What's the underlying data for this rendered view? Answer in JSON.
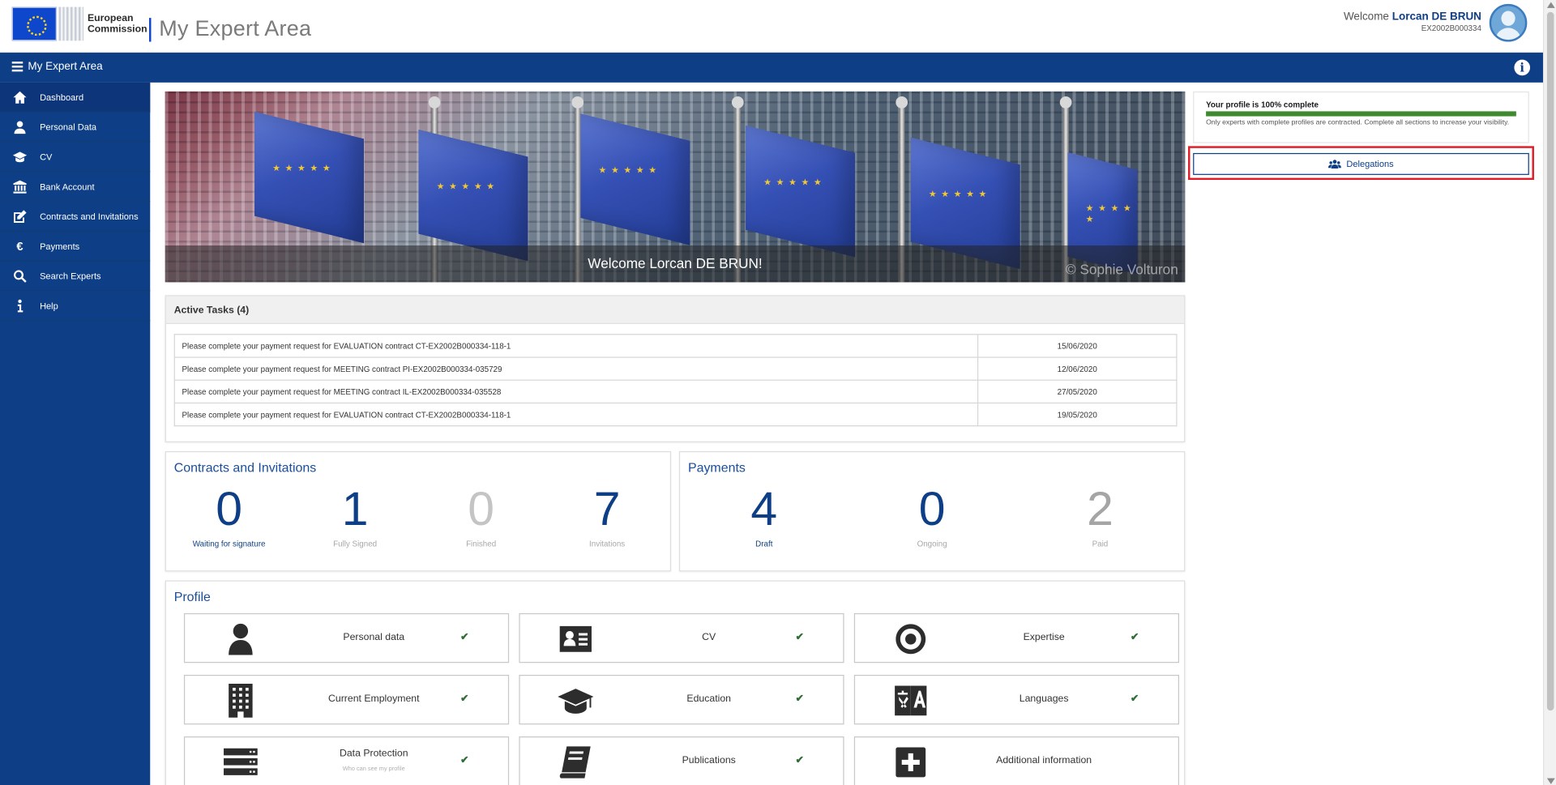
{
  "header": {
    "brand_line1": "European",
    "brand_line2": "Commission",
    "app_title": "My Expert Area",
    "welcome_prefix": "Welcome",
    "user_name": "Lorcan DE BRUN",
    "expert_id": "EX2002B000334"
  },
  "topbar": {
    "title": "My Expert Area"
  },
  "sidebar": {
    "items": [
      {
        "label": "Dashboard",
        "icon": "home-icon",
        "active": true
      },
      {
        "label": "Personal Data",
        "icon": "user-icon"
      },
      {
        "label": "CV",
        "icon": "graduation-cap-icon"
      },
      {
        "label": "Bank Account",
        "icon": "bank-icon"
      },
      {
        "label": "Contracts and Invitations",
        "icon": "edit-icon"
      },
      {
        "label": "Payments",
        "icon": "euro-icon"
      },
      {
        "label": "Search Experts",
        "icon": "search-icon"
      },
      {
        "label": "Help",
        "icon": "info-icon"
      }
    ]
  },
  "banner": {
    "welcome_text": "Welcome Lorcan DE BRUN!",
    "credit": "© Sophie Volturon"
  },
  "tasks": {
    "title": "Active Tasks (4)",
    "rows": [
      {
        "text": "Please complete your payment request for EVALUATION contract CT-EX2002B000334-118-1",
        "date": "15/06/2020"
      },
      {
        "text": "Please complete your payment request for MEETING contract PI-EX2002B000334-035729",
        "date": "12/06/2020"
      },
      {
        "text": "Please complete your payment request for MEETING contract IL-EX2002B000334-035528",
        "date": "27/05/2020"
      },
      {
        "text": "Please complete your payment request for EVALUATION contract CT-EX2002B000334-118-1",
        "date": "19/05/2020"
      }
    ]
  },
  "contracts": {
    "title": "Contracts and Invitations",
    "counters": [
      {
        "value": "0",
        "label": "Waiting for signature"
      },
      {
        "value": "1",
        "label": "Fully Signed"
      },
      {
        "value": "0",
        "label": "Finished"
      },
      {
        "value": "7",
        "label": "Invitations"
      }
    ]
  },
  "payments": {
    "title": "Payments",
    "counters": [
      {
        "value": "4",
        "label": "Draft"
      },
      {
        "value": "0",
        "label": "Ongoing"
      },
      {
        "value": "2",
        "label": "Paid"
      }
    ]
  },
  "profile": {
    "title": "Profile",
    "tiles": [
      {
        "label": "Personal data",
        "icon": "person-icon",
        "complete": true
      },
      {
        "label": "CV",
        "icon": "id-card-icon",
        "complete": true
      },
      {
        "label": "Expertise",
        "icon": "target-icon",
        "complete": true
      },
      {
        "label": "Current Employment",
        "icon": "building-icon",
        "complete": true
      },
      {
        "label": "Education",
        "icon": "graduation-cap-icon",
        "complete": true
      },
      {
        "label": "Languages",
        "icon": "language-icon",
        "complete": true
      },
      {
        "label": "Data Protection",
        "sublabel": "Who can see my profile",
        "icon": "server-icon",
        "complete": true
      },
      {
        "label": "Publications",
        "icon": "book-icon",
        "complete": true
      },
      {
        "label": "Additional information",
        "icon": "plus-square-icon",
        "complete": false
      }
    ],
    "check_glyph": "✔"
  },
  "profile_status": {
    "title": "Your profile is 100% complete",
    "progress_percent": 100,
    "note": "Only experts with complete profiles are contracted. Complete all sections to increase your visibility.",
    "bar_color": "#3f8a2f"
  },
  "delegations": {
    "label": "Delegations",
    "highlight_color": "#dd1e28"
  },
  "colors": {
    "brand": "#0e3f86",
    "accent": "#1a4d9c",
    "muted": "#9a9a9a"
  }
}
